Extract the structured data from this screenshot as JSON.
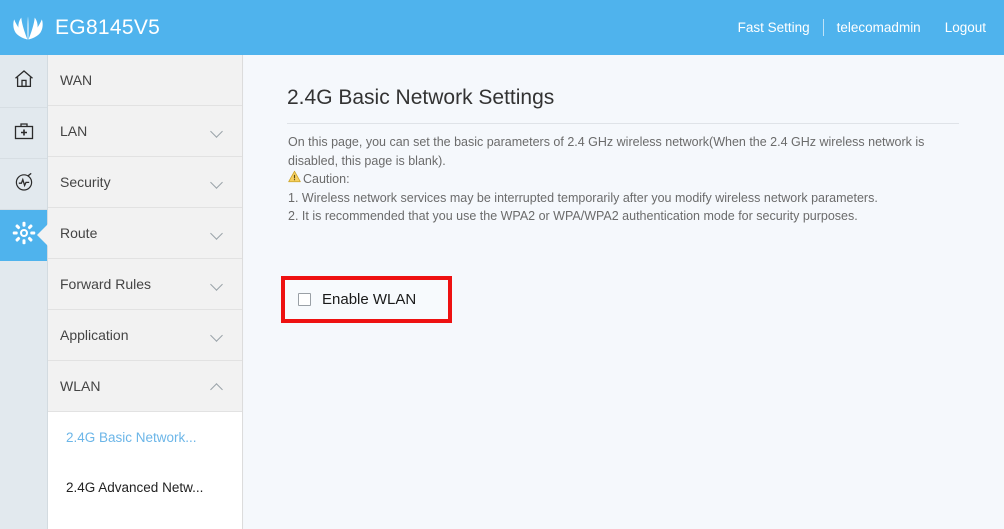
{
  "header": {
    "brand_name": "EG8145V5",
    "logo_icon": "huawei-flower-logo",
    "fast_setting": "Fast Setting",
    "username": "telecomadmin",
    "logout": "Logout"
  },
  "icon_rail": {
    "items": [
      {
        "icon": "home-icon",
        "active": false
      },
      {
        "icon": "toolbox-plus-icon",
        "active": false
      },
      {
        "icon": "diagnosis-gauge-icon",
        "active": false
      },
      {
        "icon": "gear-icon",
        "active": true
      }
    ]
  },
  "sidebar": {
    "items": [
      {
        "label": "WAN",
        "chevron": "none"
      },
      {
        "label": "LAN",
        "chevron": "down"
      },
      {
        "label": "Security",
        "chevron": "down"
      },
      {
        "label": "Route",
        "chevron": "down"
      },
      {
        "label": "Forward Rules",
        "chevron": "down"
      },
      {
        "label": "Application",
        "chevron": "down"
      },
      {
        "label": "WLAN",
        "chevron": "up"
      }
    ],
    "submenu": [
      {
        "label": "2.4G Basic Network...",
        "selected": true
      },
      {
        "label": "2.4G Advanced Netw...",
        "selected": false
      }
    ]
  },
  "main": {
    "title": "2.4G Basic Network Settings",
    "description": "On this page, you can set the basic parameters of 2.4 GHz wireless network(When the 2.4 GHz wireless network is disabled, this page is blank).",
    "caution_icon": "warning-triangle-icon",
    "caution_label": "Caution:",
    "caution_items": [
      "1. Wireless network services may be interrupted temporarily after you modify wireless network parameters.",
      "2. It is recommended that you use the WPA2 or WPA/WPA2 authentication mode for security purposes."
    ],
    "enable_wlan": {
      "label": "Enable WLAN",
      "checked": false,
      "highlight_color": "#ee1111"
    }
  },
  "colors": {
    "header_blue": "#4fb3ed",
    "accent_blue": "#6cb6e8",
    "rail_bg": "#e2e9ee",
    "menu_bg": "#f2f2f2",
    "content_bg": "#f5f8fc",
    "warning_yellow": "#f5c518"
  }
}
